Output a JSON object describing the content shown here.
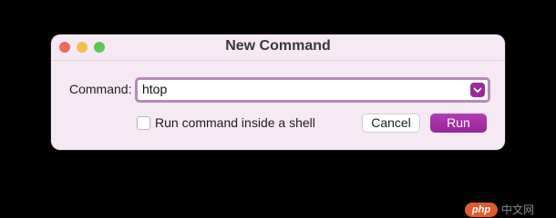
{
  "window": {
    "title": "New Command",
    "traffic_lights": {
      "close_color": "#ed6a5e",
      "minimize_color": "#f4bf4f",
      "maximize_color": "#61c554"
    }
  },
  "form": {
    "command_label": "Command:",
    "command_value": "htop",
    "dropdown_icon": "chevron-down-icon",
    "checkbox_label": "Run command inside a shell",
    "checkbox_checked": false
  },
  "buttons": {
    "cancel_label": "Cancel",
    "run_label": "Run"
  },
  "colors": {
    "accent": "#9a2a9b",
    "window_bg": "#f6e9f4"
  },
  "watermark": {
    "logo_text": "php",
    "text": "中文网"
  }
}
